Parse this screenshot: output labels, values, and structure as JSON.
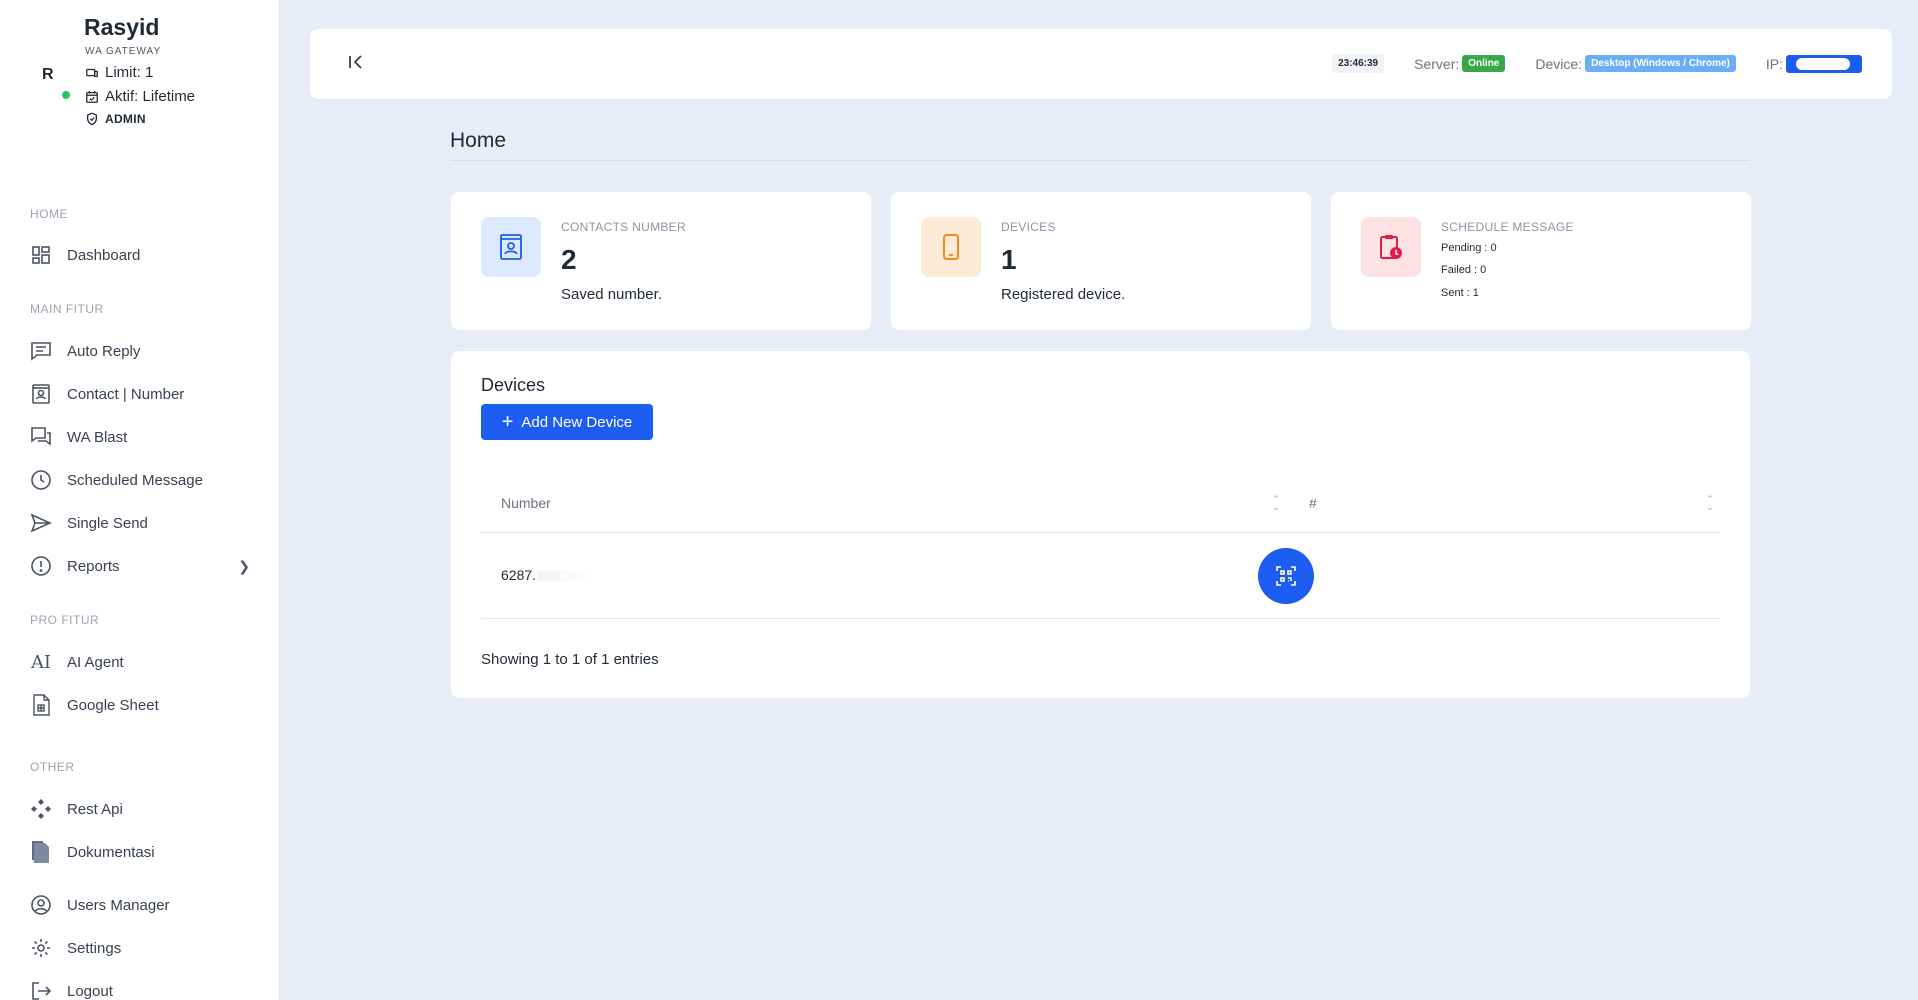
{
  "profile": {
    "initial": "R",
    "name": "Rasyid",
    "subtitle": "WA GATEWAY",
    "limit": "Limit: 1",
    "active": "Aktif: Lifetime",
    "role": "ADMIN"
  },
  "sidebar": {
    "sections": {
      "home": "HOME",
      "main": "MAIN FITUR",
      "pro": "PRO FITUR",
      "other": "OTHER"
    },
    "items": {
      "dashboard": "Dashboard",
      "auto_reply": "Auto Reply",
      "contact": "Contact | Number",
      "wa_blast": "WA Blast",
      "scheduled": "Scheduled Message",
      "single_send": "Single Send",
      "reports": "Reports",
      "ai_agent": "AI Agent",
      "google_sheet": "Google Sheet",
      "rest_api": "Rest Api",
      "dokumentasi": "Dokumentasi",
      "users_manager": "Users Manager",
      "settings": "Settings",
      "logout": "Logout"
    }
  },
  "topbar": {
    "time": "23:46:39",
    "server_label": "Server:",
    "server_status": "Online",
    "device_label": "Device:",
    "device_value": "Desktop (Windows / Chrome)",
    "ip_label": "IP:"
  },
  "page": {
    "title": "Home"
  },
  "stats": {
    "contacts": {
      "label": "CONTACTS NUMBER",
      "value": "2",
      "sub": "Saved number."
    },
    "devices": {
      "label": "DEVICES",
      "value": "1",
      "sub": "Registered device."
    },
    "schedule": {
      "label": "SCHEDULE MESSAGE",
      "pending": "Pending : 0",
      "failed": "Failed : 0",
      "sent": "Sent : 1"
    }
  },
  "devices_card": {
    "title": "Devices",
    "add_button": "Add New Device",
    "columns": [
      "Number",
      "#"
    ],
    "rows": [
      {
        "number": "6287."
      }
    ],
    "footer": "Showing 1 to 1 of 1 entries"
  },
  "colors": {
    "accent": "#1d5cf1",
    "online": "#38a84a",
    "device_badge": "#6aaef7",
    "background": "#e8ecf7"
  }
}
